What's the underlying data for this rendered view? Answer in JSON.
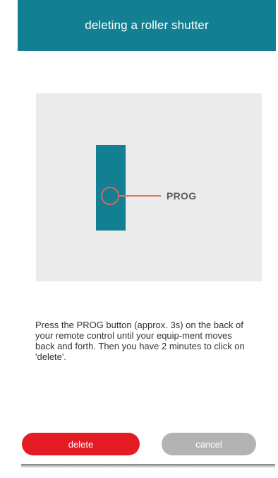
{
  "dialog": {
    "title": "deleting a roller shutter",
    "illustration": {
      "button_label": "PROG",
      "remote_color": "#137f93",
      "indicator_color": "#d9645a",
      "icon": "remote-control-icon"
    },
    "instructions": "Press the PROG button (approx. 3s) on the back of your remote control until your equip-ment moves back and forth. Then you have 2 minutes to click on 'delete'.",
    "buttons": {
      "delete_label": "delete",
      "cancel_label": "cancel"
    }
  },
  "colors": {
    "header": "#137f93",
    "primary_action": "#e41b23",
    "secondary_action": "#b3b3b3"
  }
}
